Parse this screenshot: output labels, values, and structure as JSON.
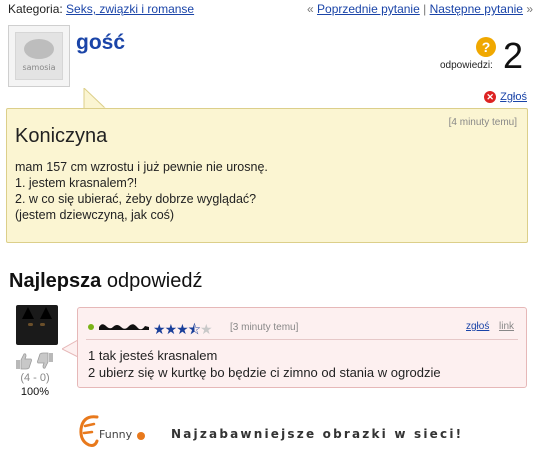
{
  "breadcrumb": {
    "category_label": "Kategoria: ",
    "category_link": "Seks, związki i romanse",
    "nav_prefix": "« ",
    "prev_link": "Poprzednie pytanie",
    "separator": " | ",
    "next_link": "Następne pytanie",
    "nav_suffix": " »"
  },
  "question": {
    "author": "gość",
    "avatar_text": "samosia",
    "answers_label": "odpowiedzi:",
    "answers_count": "2",
    "report_label": "Zgłoś",
    "time": "[4 minuty temu]",
    "title": "Koniczyna",
    "body": [
      "mam 157 cm wzrostu i już pewnie nie urosnę.",
      "1. jestem krasnalem?!",
      "2. w co się ubierać, żeby dobrze wyglądać?",
      "(jestem dziewczyną, jak coś)"
    ]
  },
  "best_answer": {
    "heading_bold": "Najlepsza",
    "heading_rest": " odpowiedź",
    "rating": 3.5,
    "rating_max": 5,
    "time": "[3 minuty temu]",
    "report_label": "zgłoś",
    "link_label": "link",
    "votes": "(4 - 0)",
    "percent": "100%",
    "body": [
      "1 tak jesteś krasnalem",
      "2 ubierz się w kurtkę bo będzie ci zimno od stania w ogrodzie"
    ]
  },
  "banner": {
    "logo_text": "Funny",
    "text": "Najzabawniejsze obrazki w sieci!"
  },
  "colors": {
    "link": "#1a44a8",
    "question_bg": "#fbf5d2",
    "answer_bg": "#fdf0f0",
    "badge": "#f0a800",
    "report_icon": "#d22222",
    "logo": "#e8791c"
  }
}
